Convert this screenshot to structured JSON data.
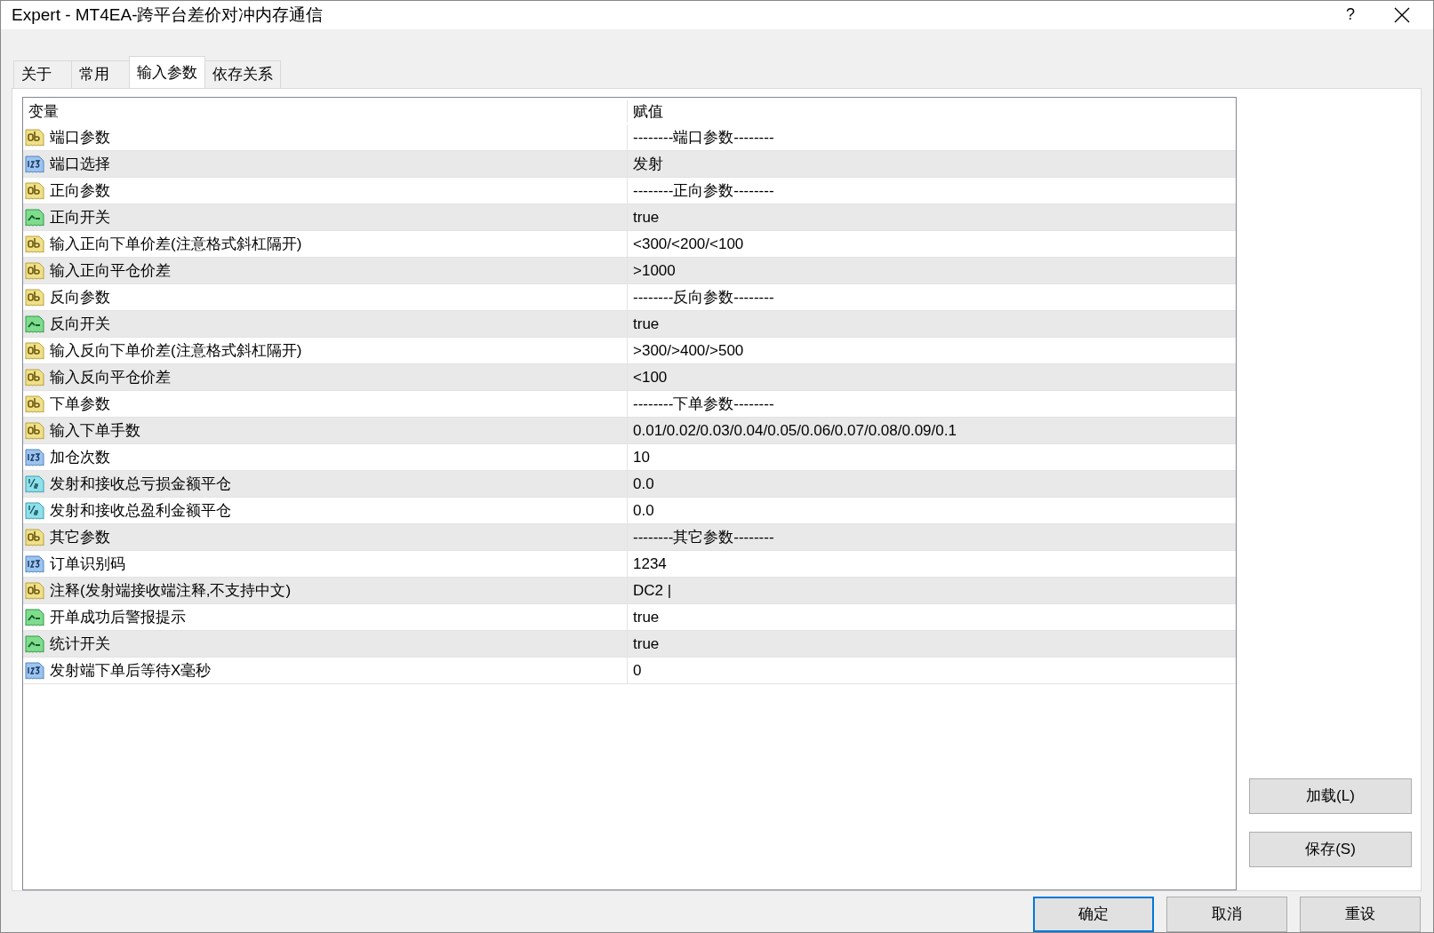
{
  "window": {
    "title": "Expert - MT4EA-跨平台差价对冲内存通信",
    "help": "?"
  },
  "tabs": [
    {
      "label": "关于",
      "selected": false
    },
    {
      "label": "常用",
      "selected": false
    },
    {
      "label": "输入参数",
      "selected": true
    },
    {
      "label": "依存关系",
      "selected": false
    }
  ],
  "table": {
    "columns": [
      "变量",
      "赋值"
    ],
    "rows": [
      {
        "kind": "text",
        "name": "端口参数",
        "value": "--------端口参数--------"
      },
      {
        "kind": "int",
        "name": "端口选择",
        "value": "发射"
      },
      {
        "kind": "text",
        "name": "正向参数",
        "value": "--------正向参数--------"
      },
      {
        "kind": "bool",
        "name": "正向开关",
        "value": "true"
      },
      {
        "kind": "text",
        "name": "输入正向下单价差(注意格式斜杠隔开)",
        "value": "<300/<200/<100"
      },
      {
        "kind": "text",
        "name": "输入正向平仓价差",
        "value": ">1000"
      },
      {
        "kind": "text",
        "name": "反向参数",
        "value": "--------反向参数--------"
      },
      {
        "kind": "bool",
        "name": "反向开关",
        "value": "true"
      },
      {
        "kind": "text",
        "name": "输入反向下单价差(注意格式斜杠隔开)",
        "value": ">300/>400/>500"
      },
      {
        "kind": "text",
        "name": "输入反向平仓价差",
        "value": "<100"
      },
      {
        "kind": "text",
        "name": "下单参数",
        "value": "--------下单参数--------"
      },
      {
        "kind": "text",
        "name": "输入下单手数",
        "value": "0.01/0.02/0.03/0.04/0.05/0.06/0.07/0.08/0.09/0.1"
      },
      {
        "kind": "int",
        "name": "加仓次数",
        "value": "10"
      },
      {
        "kind": "double",
        "name": "发射和接收总亏损金额平仓",
        "value": "0.0"
      },
      {
        "kind": "double",
        "name": "发射和接收总盈利金额平仓",
        "value": "0.0"
      },
      {
        "kind": "text",
        "name": "其它参数",
        "value": "--------其它参数--------"
      },
      {
        "kind": "int",
        "name": "订单识别码",
        "value": "1234"
      },
      {
        "kind": "text",
        "name": "注释(发射端接收端注释,不支持中文)",
        "value": "DC2 |"
      },
      {
        "kind": "bool",
        "name": "开单成功后警报提示",
        "value": "true"
      },
      {
        "kind": "bool",
        "name": "统计开关",
        "value": "true"
      },
      {
        "kind": "int",
        "name": "发射端下单后等待X毫秒",
        "value": "0"
      }
    ]
  },
  "side_buttons": [
    "加载(L)",
    "保存(S)"
  ],
  "buttons": [
    {
      "label": "确定",
      "default": true
    },
    {
      "label": "取消",
      "default": false
    },
    {
      "label": "重设",
      "default": false
    }
  ]
}
